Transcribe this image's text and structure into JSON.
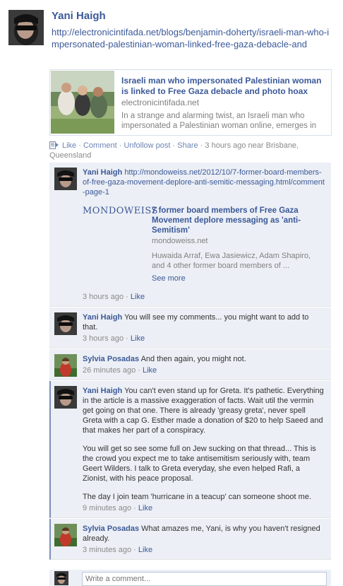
{
  "post": {
    "author": "Yani Haigh",
    "url_text": "http://electronicintifada.net/blogs/benjamin-doherty/israeli-man-who-impersonated-palestinian-woman-linked-free-gaza-debacle-and"
  },
  "shared_link": {
    "title": "Israeli man who impersonated Palestinian woman is linked to Free Gaza debacle and photo hoax",
    "domain": "electronicintifada.net",
    "description": "In a strange and alarming twist, an Israeli man who impersonated a Palestinian woman online, emerges in"
  },
  "actions": {
    "like": "Like",
    "comment": "Comment",
    "unfollow": "Unfollow post",
    "share": "Share",
    "sep": " · ",
    "timestamp": "3 hours ago near Brisbane, Queensland"
  },
  "comments": [
    {
      "author": "Yani Haigh",
      "text": "http://mondoweiss.net/2012/10/7-former-board-members-of-free-gaza-movement-deplore-anti-semitic-messaging.html/comment-page-1",
      "attachment": {
        "site_logo": "MONDOWEISS",
        "title": "7 former board members of Free Gaza Movement deplore messaging as 'anti-Semitism'",
        "domain": "mondoweiss.net",
        "description": "Huwaida Arraf, Ewa Jasiewicz, Adam Shapiro, and 4 other former board members of ...",
        "see_more": "See more"
      },
      "time": "3 hours ago",
      "like": "Like"
    },
    {
      "author": "Yani Haigh",
      "text": "You will see my comments... you might want to add to that.",
      "time": "3 hours ago",
      "like": "Like"
    },
    {
      "author": "Sylvia Posadas",
      "text": "And then again, you might not.",
      "time": "26 minutes ago",
      "like": "Like"
    },
    {
      "author": "Yani Haigh",
      "text": "You can't even stand up for Greta. It's pathetic. Everything in the article is a massive exaggeration of facts. Wait util the vermin get going on that one. There is already 'greasy greta', never spell Greta with a cap G. Esther made a donation of $20 to help Saeed and that makes her part of a conspiracy.",
      "para2": "You will get so see some full on Jew sucking on that thread... This is the crowd you expect me to take antisemitism seriously with, team Geert Wilders. I talk to Greta everyday, she even helped Rafi, a Zionist, with his peace proposal.",
      "para3": "The day I join team 'hurricane in a teacup' can someone shoot me.",
      "time": "9 minutes ago",
      "like": "Like"
    },
    {
      "author": "Sylvia Posadas",
      "text": "What amazes me, Yani, is why you haven't resigned already.",
      "time": "3 minutes ago",
      "like": "Like"
    }
  ],
  "composer": {
    "placeholder": "Write a comment..."
  },
  "colors": {
    "link": "#3b5998",
    "comment_bg": "#eceff5",
    "muted": "#8a8a8a"
  }
}
